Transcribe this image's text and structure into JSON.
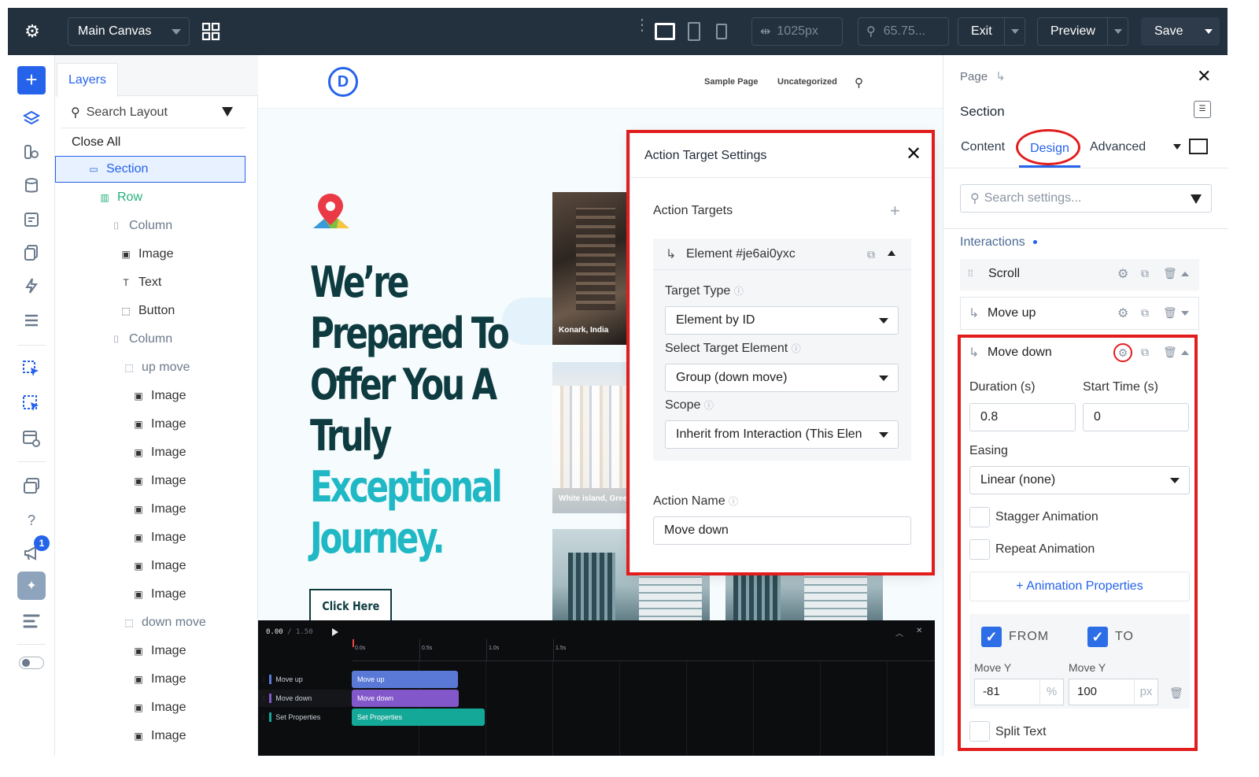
{
  "topbar": {
    "canvas_select": "Main Canvas",
    "width_value": "1025px",
    "zoom_value": "65.75...",
    "exit_label": "Exit",
    "preview_label": "Preview",
    "save_label": "Save"
  },
  "leftrail": {
    "badge_count": "1"
  },
  "layers": {
    "tab_label": "Layers",
    "search_placeholder": "Search Layout",
    "close_all": "Close All",
    "items": [
      {
        "label": "Section",
        "icon": "section-icon"
      },
      {
        "label": "Row",
        "icon": "row-icon"
      },
      {
        "label": "Column",
        "icon": "column-icon"
      },
      {
        "label": "Image",
        "icon": "image-icon"
      },
      {
        "label": "Text",
        "icon": "text-icon"
      },
      {
        "label": "Button",
        "icon": "button-icon"
      },
      {
        "label": "Column",
        "icon": "column-icon"
      },
      {
        "label": "up move",
        "icon": "group-icon"
      },
      {
        "label": "Image",
        "icon": "image-icon"
      },
      {
        "label": "Image",
        "icon": "image-icon"
      },
      {
        "label": "Image",
        "icon": "image-icon"
      },
      {
        "label": "Image",
        "icon": "image-icon"
      },
      {
        "label": "Image",
        "icon": "image-icon"
      },
      {
        "label": "Image",
        "icon": "image-icon"
      },
      {
        "label": "Image",
        "icon": "image-icon"
      },
      {
        "label": "Image",
        "icon": "image-icon"
      },
      {
        "label": "down move",
        "icon": "group-icon"
      },
      {
        "label": "Image",
        "icon": "image-icon"
      },
      {
        "label": "Image",
        "icon": "image-icon"
      },
      {
        "label": "Image",
        "icon": "image-icon"
      },
      {
        "label": "Image",
        "icon": "image-icon"
      }
    ]
  },
  "site": {
    "logo_letter": "D",
    "nav": [
      "Sample Page",
      "Uncategorized"
    ],
    "hero_line1": "We’re",
    "hero_line2": "Prepared To",
    "hero_line3": "Offer You A",
    "hero_line4": "Truly",
    "hero_line5": "Exceptional",
    "hero_line6": "Journey.",
    "cta_label": "Click Here",
    "caption1": "Konark, India",
    "caption2": "White island, Greece"
  },
  "modal": {
    "title": "Action Target Settings",
    "targets_label": "Action Targets",
    "element_label": "Element #je6ai0yxc",
    "target_type_label": "Target Type",
    "target_type_value": "Element by ID",
    "select_target_label": "Select Target Element",
    "select_target_value": "Group (down move)",
    "scope_label": "Scope",
    "scope_value": "Inherit from Interaction (This Elen",
    "action_name_label": "Action Name",
    "action_name_value": "Move down"
  },
  "timeline": {
    "current": "0.00",
    "total": "/ 1.50",
    "ticks": [
      "0.0s",
      "0.5s",
      "1.0s",
      "1.5s"
    ],
    "rows": [
      {
        "label": "Move up",
        "color": "#5a79d6"
      },
      {
        "label": "Move down",
        "color": "#8257c9"
      },
      {
        "label": "Set Properties",
        "color": "#14a898"
      }
    ]
  },
  "right": {
    "breadcrumb": "Page",
    "title": "Section",
    "tabs": [
      "Content",
      "Design",
      "Advanced"
    ],
    "search_placeholder": "Search settings...",
    "interactions_label": "Interactions",
    "scroll_label": "Scroll",
    "move_up_label": "Move up",
    "move_down_label": "Move down",
    "duration_label": "Duration (s)",
    "duration_value": "0.8",
    "start_label": "Start Time (s)",
    "start_value": "0",
    "easing_label": "Easing",
    "easing_value": "Linear (none)",
    "stagger_label": "Stagger Animation",
    "repeat_label": "Repeat Animation",
    "anim_props_label": "+ Animation Properties",
    "from_label": "FROM",
    "to_label": "TO",
    "from_prop": "Move Y",
    "to_prop": "Move Y",
    "from_value": "-81",
    "from_unit": "%",
    "to_value": "100",
    "to_unit": "px",
    "split_label": "Split Text"
  },
  "colors": {
    "accent": "#2563eb",
    "highlight_red": "#e11d1d",
    "hero_dark": "#0e3b40",
    "hero_teal": "#1fb8c4"
  }
}
